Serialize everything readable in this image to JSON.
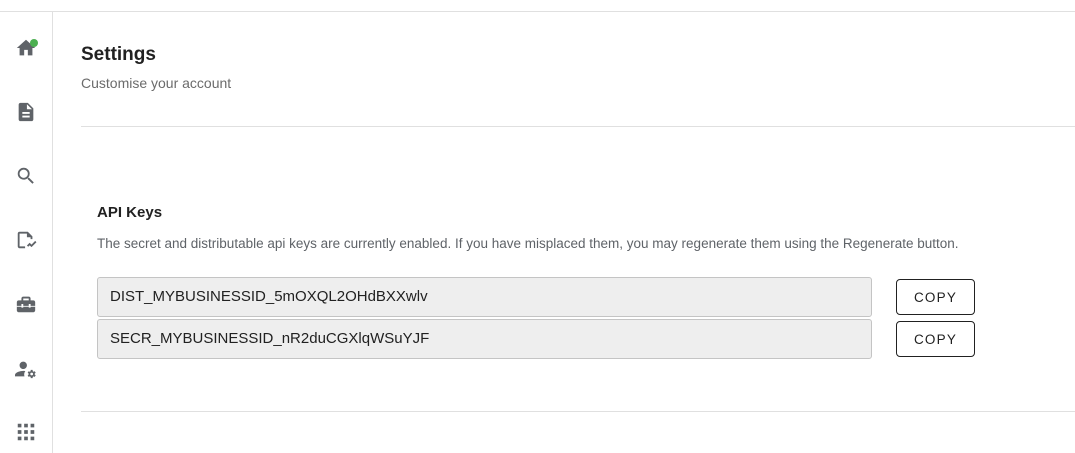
{
  "header": {
    "title": "Settings",
    "subtitle": "Customise your account"
  },
  "sidebar": {
    "items": [
      {
        "icon": "home-icon",
        "has_status_dot": true,
        "status_color": "#4caf50"
      },
      {
        "icon": "document-icon"
      },
      {
        "icon": "search-icon"
      },
      {
        "icon": "analytics-document-icon"
      },
      {
        "icon": "toolbox-icon"
      },
      {
        "icon": "user-settings-icon"
      },
      {
        "icon": "apps-grid-icon"
      }
    ]
  },
  "api_keys": {
    "title": "API Keys",
    "description": "The secret and distributable api keys are currently enabled. If you have misplaced them, you may regenerate them using the Regenerate button.",
    "keys": [
      {
        "value": "DIST_MYBUSINESSID_5mOXQL2OHdBXXwlv",
        "copy_label": "COPY"
      },
      {
        "value": "SECR_MYBUSINESSID_nR2duCGXlqWSuYJF",
        "copy_label": "COPY"
      }
    ]
  }
}
